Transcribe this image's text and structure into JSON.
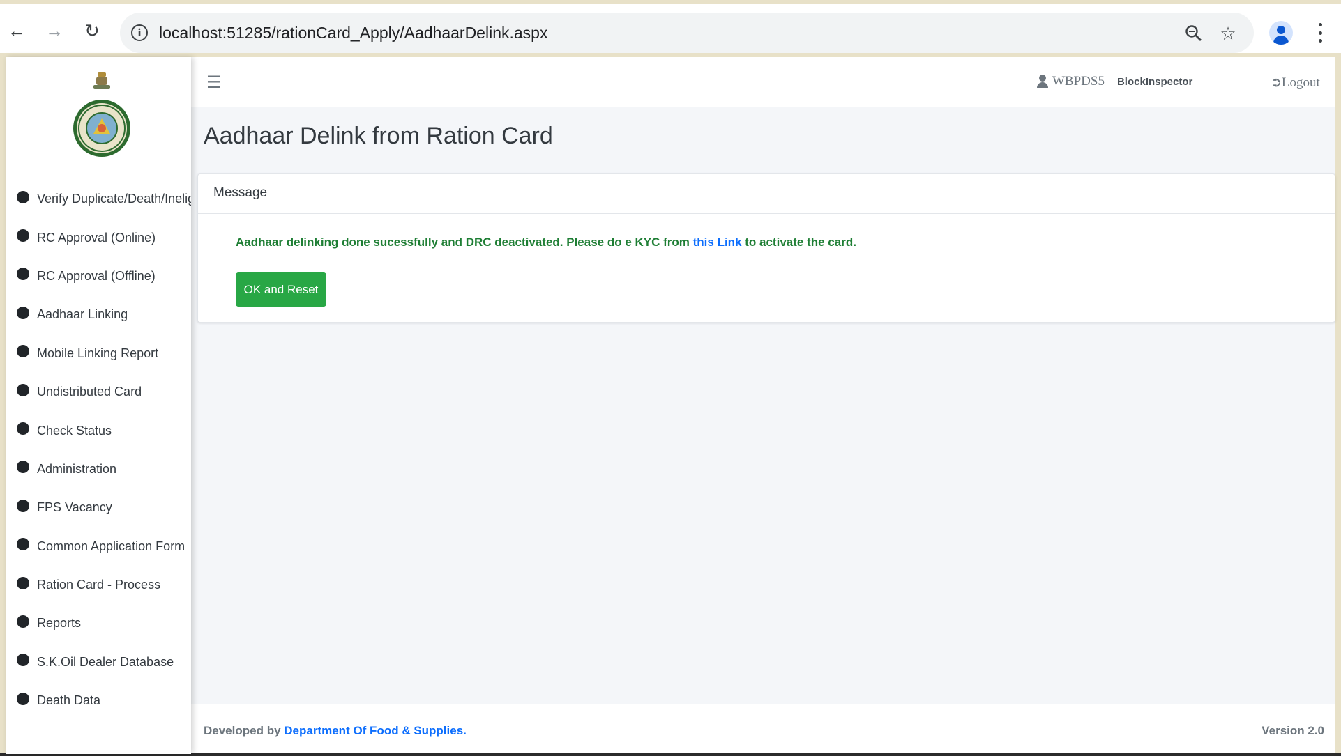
{
  "browser": {
    "url": "localhost:51285/rationCard_Apply/AadhaarDelink.aspx",
    "back_icon": "arrow-left-icon",
    "forward_icon": "arrow-right-icon",
    "reload_icon": "reload-icon",
    "zoom_icon": "zoom-icon",
    "bookmark_icon": "star-icon",
    "profile_icon": "avatar-icon",
    "menu_icon": "kebab-menu-icon",
    "accent_color": "#0b57d0"
  },
  "sidebar": {
    "logo_icon": "west-bengal-emblem-icon",
    "items": [
      {
        "label": "Verify Duplicate/Death/Ineligible"
      },
      {
        "label": "RC Approval (Online)"
      },
      {
        "label": "RC Approval (Offline)"
      },
      {
        "label": "Aadhaar Linking"
      },
      {
        "label": "Mobile Linking Report"
      },
      {
        "label": "Undistributed Card"
      },
      {
        "label": "Check Status"
      },
      {
        "label": "Administration"
      },
      {
        "label": "FPS Vacancy"
      },
      {
        "label": "Common Application Form"
      },
      {
        "label": "Ration Card - Process"
      },
      {
        "label": "Reports"
      },
      {
        "label": "S.K.Oil Dealer Database"
      },
      {
        "label": "Death Data"
      }
    ]
  },
  "topbar": {
    "menu_icon": "hamburger-icon",
    "username": "WBPDS5",
    "role": "BlockInspector",
    "logout_label": "Logout"
  },
  "main": {
    "title": "Aadhaar Delink from Ration Card",
    "card": {
      "header": "Message",
      "message_before": "Aadhaar delinking done sucessfully and DRC deactivated. Please do e KYC from ",
      "message_link": "this Link",
      "message_after": " to activate the card.",
      "button_label": "OK and Reset",
      "success_color": "#28a745"
    }
  },
  "footer": {
    "developed_by": "Developed by ",
    "department": "Department Of Food & Supplies.",
    "version": "Version 2.0"
  }
}
